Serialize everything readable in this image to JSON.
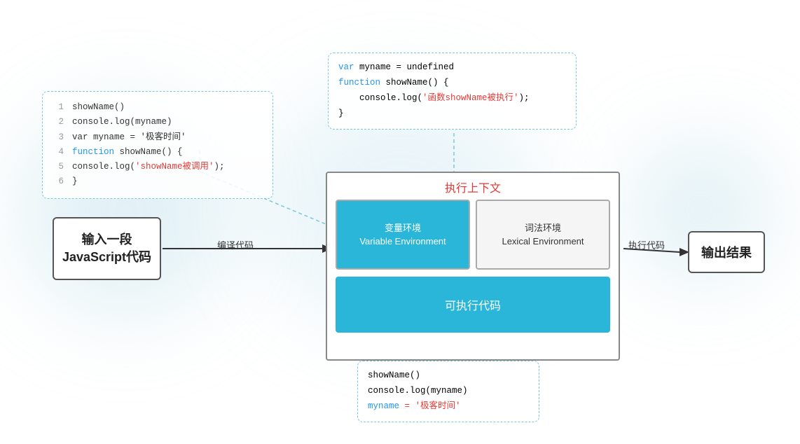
{
  "background": {
    "glow_colors": [
      "#add8e6",
      "#b0e0e8"
    ]
  },
  "code_box_main": {
    "lines": [
      {
        "num": "1",
        "content": "showName()"
      },
      {
        "num": "2",
        "content": "console.log(myname)"
      },
      {
        "num": "3",
        "content": "var myname = '极客时间'"
      },
      {
        "num": "4",
        "content_kw": "function",
        "content_rest": " showName() {"
      },
      {
        "num": "5",
        "content_indent": "    console.log(",
        "content_str": "'showName被调用'",
        "content_end": ");"
      },
      {
        "num": "6",
        "content": "}"
      }
    ]
  },
  "input_box": {
    "line1": "输入一段",
    "line2": "JavaScript代码"
  },
  "compile_label": "编译代码",
  "execute_label": "执行代码",
  "output_box": {
    "label": "输出结果"
  },
  "exec_context": {
    "title": "执行上下文",
    "var_env_line1": "变量环境",
    "var_env_line2": "Variable Environment",
    "lex_env_line1": "词法环境",
    "lex_env_line2": "Lexical Environment",
    "exec_code_label": "可执行代码"
  },
  "popup_top": {
    "line1_kw": "var",
    "line1_rest": " myname = undefined",
    "line2_kw": "function",
    "line2_rest": " showName() {",
    "line3": "    console.log('函数showName被执行');",
    "line4": "}"
  },
  "popup_bottom": {
    "line1": "showName()",
    "line2": "console.log(myname)",
    "line3_kw": "myname",
    "line3_rest": " = '极客时间'"
  }
}
